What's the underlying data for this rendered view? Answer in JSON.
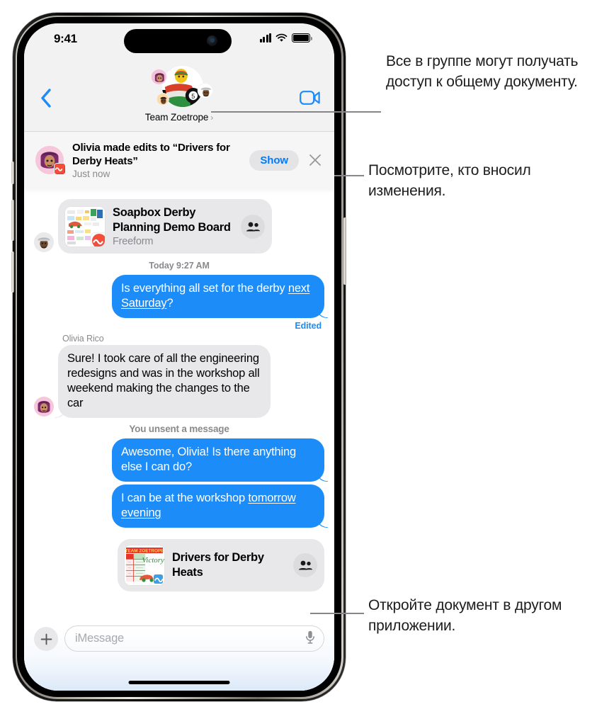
{
  "statusbar": {
    "time": "9:41",
    "cellular_icon": "signal-bars-icon",
    "wifi_icon": "wifi-icon",
    "battery_icon": "battery-full-icon"
  },
  "navbar": {
    "back_icon": "back-chevron-icon",
    "facetime_icon": "video-camera-icon",
    "group_title": "Team Zoetrope",
    "group_chevron": "›",
    "avatar_name": "group-avatar-soapbox-car"
  },
  "banner": {
    "title": "Olivia made edits to “Drivers for Derby Heats”",
    "subtitle": "Just now",
    "show_label": "Show",
    "close_icon": "close-icon",
    "avatar_name": "olivia-memoji-avatar",
    "app_badge": "freeform-app-badge"
  },
  "conversation": {
    "attachment_top": {
      "title": "Soapbox Derby Planning Demo Board",
      "app": "Freeform",
      "badge_icon": "people-collaboration-icon",
      "thumb_name": "freeform-board-thumbnail",
      "sender_avatar": "teammate-memoji-avatar"
    },
    "timestamp": "Today 9:27 AM",
    "messages": [
      {
        "id": "m1",
        "side": "out",
        "text_pre": "Is everything all set for the derby ",
        "text_link": "next Saturday",
        "text_post": "?",
        "edited_label": "Edited"
      },
      {
        "id": "m2",
        "side": "in",
        "sender": "Olivia Rico",
        "text": "Sure! I took care of all the engineering redesigns and was in the workshop all weekend making the changes to the car"
      },
      {
        "id": "m3",
        "side": "system",
        "text": "You unsent a message"
      },
      {
        "id": "m4",
        "side": "out",
        "text": "Awesome, Olivia! Is there anything else I can do?"
      },
      {
        "id": "m5",
        "side": "out",
        "text_pre": "I can be at the workshop ",
        "text_link": "tomorrow evening",
        "text_post": ""
      }
    ],
    "attachment_bottom": {
      "title": "Drivers for Derby Heats",
      "badge_icon": "people-collaboration-icon",
      "thumb_name": "numbers-spreadsheet-thumbnail"
    }
  },
  "inputbar": {
    "plus_icon": "plus-icon",
    "placeholder": "iMessage",
    "mic_icon": "microphone-icon",
    "value": ""
  },
  "callouts": [
    {
      "id": "callout-1",
      "text": "Все в группе могут получать доступ к общему документу."
    },
    {
      "id": "callout-2",
      "text": "Посмотрите, кто вносил изменения."
    },
    {
      "id": "callout-3",
      "text": "Откройте документ в другом приложении."
    }
  ],
  "colors": {
    "imessage_blue": "#1c8cf8",
    "gray_bubble": "#e8e8ea",
    "accent_link": "#007aff",
    "secondary_text": "#8a8a8e",
    "leader_line": "#86868b"
  }
}
